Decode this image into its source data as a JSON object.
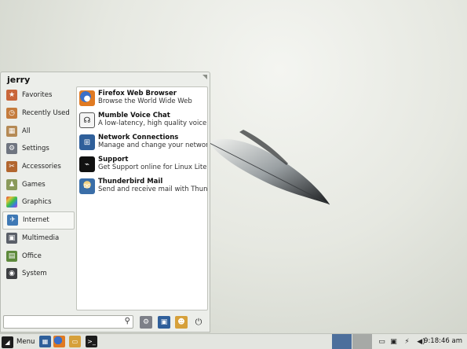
{
  "menu": {
    "username": "jerry",
    "categories": [
      {
        "label": "Favorites",
        "icon": "favorites-icon",
        "color": "#c9663a"
      },
      {
        "label": "Recently Used",
        "icon": "recently-used-icon",
        "color": "#c47b3c"
      },
      {
        "label": "All",
        "icon": "all-icon",
        "color": "#b58a55"
      },
      {
        "label": "Settings",
        "icon": "settings-icon",
        "color": "#6f7580"
      },
      {
        "label": "Accessories",
        "icon": "accessories-icon",
        "color": "#b2662f"
      },
      {
        "label": "Games",
        "icon": "games-icon",
        "color": "#8a9a5b"
      },
      {
        "label": "Graphics",
        "icon": "graphics-icon",
        "color": "#c044c2"
      },
      {
        "label": "Internet",
        "icon": "internet-icon",
        "color": "#3f79b5"
      },
      {
        "label": "Multimedia",
        "icon": "multimedia-icon",
        "color": "#5a5f68"
      },
      {
        "label": "Office",
        "icon": "office-icon",
        "color": "#5e8a3c"
      },
      {
        "label": "System",
        "icon": "system-icon",
        "color": "#3d3f42"
      }
    ],
    "selected_category": "Internet",
    "apps": [
      {
        "name": "Firefox Web Browser",
        "desc": "Browse the World Wide Web",
        "icon": "firefox-icon",
        "color": "#e07a22"
      },
      {
        "name": "Mumble Voice Chat",
        "desc": "A low-latency, high quality voice c...",
        "icon": "mumble-icon",
        "color": "#2a2a2a"
      },
      {
        "name": "Network Connections",
        "desc": "Manage and change your networ...",
        "icon": "network-icon",
        "color": "#2f5f9a"
      },
      {
        "name": "Support",
        "desc": "Get Support online for Linux Lite",
        "icon": "support-icon",
        "color": "#111111"
      },
      {
        "name": "Thunderbird Mail",
        "desc": "Send and receive mail with Thund...",
        "icon": "thunderbird-icon",
        "color": "#3a6ea8"
      }
    ],
    "search": {
      "value": "",
      "placeholder": ""
    }
  },
  "taskbar": {
    "menu_label": "Menu",
    "clock": "9:18:46 am",
    "workspace_colors": [
      "#4d6f9c",
      "#a6a9a6"
    ]
  }
}
